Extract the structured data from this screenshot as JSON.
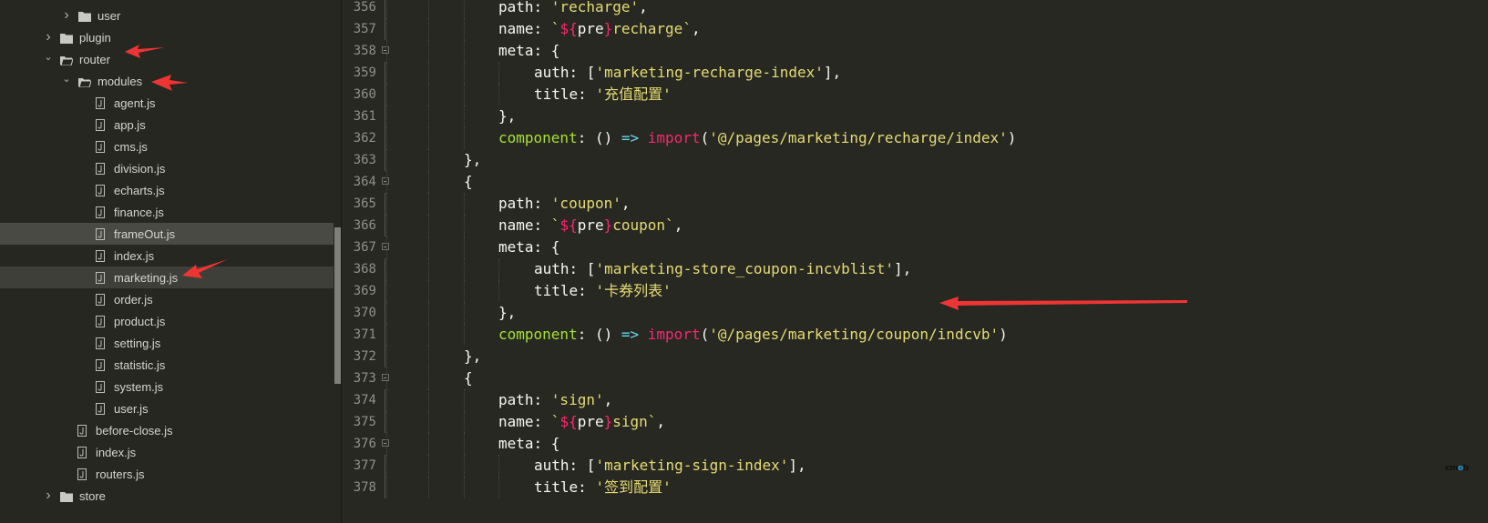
{
  "sidebar": {
    "items": [
      {
        "label": "user",
        "type": "folder",
        "level": 2,
        "expanded": false
      },
      {
        "label": "plugin",
        "type": "folder",
        "level": 1,
        "expanded": false
      },
      {
        "label": "router",
        "type": "folder",
        "level": 1,
        "expanded": true
      },
      {
        "label": "modules",
        "type": "folder",
        "level": 2,
        "expanded": true
      },
      {
        "label": "agent.js",
        "type": "file",
        "level": 3
      },
      {
        "label": "app.js",
        "type": "file",
        "level": 3
      },
      {
        "label": "cms.js",
        "type": "file",
        "level": 3
      },
      {
        "label": "division.js",
        "type": "file",
        "level": 3
      },
      {
        "label": "echarts.js",
        "type": "file",
        "level": 3
      },
      {
        "label": "finance.js",
        "type": "file",
        "level": 3
      },
      {
        "label": "frameOut.js",
        "type": "file",
        "level": 3,
        "state": "hover"
      },
      {
        "label": "index.js",
        "type": "file",
        "level": 3
      },
      {
        "label": "marketing.js",
        "type": "file",
        "level": 3,
        "state": "selected"
      },
      {
        "label": "order.js",
        "type": "file",
        "level": 3
      },
      {
        "label": "product.js",
        "type": "file",
        "level": 3
      },
      {
        "label": "setting.js",
        "type": "file",
        "level": 3
      },
      {
        "label": "statistic.js",
        "type": "file",
        "level": 3
      },
      {
        "label": "system.js",
        "type": "file",
        "level": 3
      },
      {
        "label": "user.js",
        "type": "file",
        "level": 3
      },
      {
        "label": "before-close.js",
        "type": "file",
        "level": 2
      },
      {
        "label": "index.js",
        "type": "file",
        "level": 2
      },
      {
        "label": "routers.js",
        "type": "file",
        "level": 2
      },
      {
        "label": "store",
        "type": "folder",
        "level": 1,
        "expanded": false
      }
    ]
  },
  "editor": {
    "lines": [
      {
        "no": "356",
        "indent": 2,
        "tokens": [
          [
            "key",
            "path: "
          ],
          [
            "str",
            "'recharge'"
          ],
          [
            "pun",
            ","
          ]
        ]
      },
      {
        "no": "357",
        "indent": 2,
        "tokens": [
          [
            "key",
            "name: "
          ],
          [
            "str",
            "`"
          ],
          [
            "tpl",
            "${"
          ],
          [
            "key",
            "pre"
          ],
          [
            "tpl",
            "}"
          ],
          [
            "str",
            "recharge`"
          ],
          [
            "pun",
            ","
          ]
        ]
      },
      {
        "no": "358",
        "indent": 2,
        "fold": true,
        "tokens": [
          [
            "key",
            "meta: {"
          ]
        ]
      },
      {
        "no": "359",
        "indent": 3,
        "tokens": [
          [
            "key",
            "auth: ["
          ],
          [
            "str",
            "'marketing-recharge-index'"
          ],
          [
            "pun",
            "],"
          ]
        ]
      },
      {
        "no": "360",
        "indent": 3,
        "tokens": [
          [
            "key",
            "title: "
          ],
          [
            "str",
            "'充值配置'"
          ]
        ]
      },
      {
        "no": "361",
        "indent": 2,
        "tokens": [
          [
            "pun",
            "},"
          ]
        ]
      },
      {
        "no": "362",
        "indent": 2,
        "tokens": [
          [
            "cmp",
            "component"
          ],
          [
            "pun",
            ": () "
          ],
          [
            "arr",
            "=>"
          ],
          [
            "pun",
            " "
          ],
          [
            "imp",
            "import"
          ],
          [
            "pun",
            "("
          ],
          [
            "str",
            "'@/pages/marketing/recharge/index'"
          ],
          [
            "pun",
            ")"
          ]
        ]
      },
      {
        "no": "363",
        "indent": 1,
        "tokens": [
          [
            "pun",
            "},"
          ]
        ]
      },
      {
        "no": "364",
        "indent": 1,
        "fold": true,
        "tokens": [
          [
            "pun",
            "{"
          ]
        ]
      },
      {
        "no": "365",
        "indent": 2,
        "tokens": [
          [
            "key",
            "path: "
          ],
          [
            "str",
            "'coupon'"
          ],
          [
            "pun",
            ","
          ]
        ]
      },
      {
        "no": "366",
        "indent": 2,
        "tokens": [
          [
            "key",
            "name: "
          ],
          [
            "str",
            "`"
          ],
          [
            "tpl",
            "${"
          ],
          [
            "key",
            "pre"
          ],
          [
            "tpl",
            "}"
          ],
          [
            "str",
            "coupon`"
          ],
          [
            "pun",
            ","
          ]
        ]
      },
      {
        "no": "367",
        "indent": 2,
        "fold": true,
        "tokens": [
          [
            "key",
            "meta: {"
          ]
        ]
      },
      {
        "no": "368",
        "indent": 3,
        "tokens": [
          [
            "key",
            "auth: ["
          ],
          [
            "str",
            "'marketing-store_coupon-incvblist'"
          ],
          [
            "pun",
            "],"
          ]
        ]
      },
      {
        "no": "369",
        "indent": 3,
        "tokens": [
          [
            "key",
            "title: "
          ],
          [
            "str",
            "'卡券列表'"
          ]
        ]
      },
      {
        "no": "370",
        "indent": 2,
        "tokens": [
          [
            "pun",
            "},"
          ]
        ]
      },
      {
        "no": "371",
        "indent": 2,
        "tokens": [
          [
            "cmp",
            "component"
          ],
          [
            "pun",
            ": () "
          ],
          [
            "arr",
            "=>"
          ],
          [
            "pun",
            " "
          ],
          [
            "imp",
            "import"
          ],
          [
            "pun",
            "("
          ],
          [
            "str",
            "'@/pages/marketing/coupon/indcvb'"
          ],
          [
            "pun",
            ")"
          ]
        ]
      },
      {
        "no": "372",
        "indent": 1,
        "tokens": [
          [
            "pun",
            "},"
          ]
        ]
      },
      {
        "no": "373",
        "indent": 1,
        "fold": true,
        "tokens": [
          [
            "pun",
            "{"
          ]
        ]
      },
      {
        "no": "374",
        "indent": 2,
        "tokens": [
          [
            "key",
            "path: "
          ],
          [
            "str",
            "'sign'"
          ],
          [
            "pun",
            ","
          ]
        ]
      },
      {
        "no": "375",
        "indent": 2,
        "tokens": [
          [
            "key",
            "name: "
          ],
          [
            "str",
            "`"
          ],
          [
            "tpl",
            "${"
          ],
          [
            "key",
            "pre"
          ],
          [
            "tpl",
            "}"
          ],
          [
            "str",
            "sign`"
          ],
          [
            "pun",
            ","
          ]
        ]
      },
      {
        "no": "376",
        "indent": 2,
        "fold": true,
        "tokens": [
          [
            "key",
            "meta: {"
          ]
        ]
      },
      {
        "no": "377",
        "indent": 3,
        "tokens": [
          [
            "key",
            "auth: ["
          ],
          [
            "str",
            "'marketing-sign-index'"
          ],
          [
            "pun",
            "],"
          ]
        ]
      },
      {
        "no": "378",
        "indent": 3,
        "tokens": [
          [
            "key",
            "title: "
          ],
          [
            "str",
            "'签到配置'"
          ]
        ]
      }
    ]
  },
  "annotations": {
    "arrow_color": "#ef3434",
    "targets": [
      "router",
      "modules",
      "marketing.js",
      "title: '卡券列表'"
    ]
  },
  "watermark": {
    "pre": "cm",
    "o": "o",
    "post": "b"
  },
  "colors": {
    "background": "#272822",
    "keyword": "#f92672",
    "string": "#e6db74",
    "function": "#a6e22e",
    "arrow": "#66d9ef"
  }
}
